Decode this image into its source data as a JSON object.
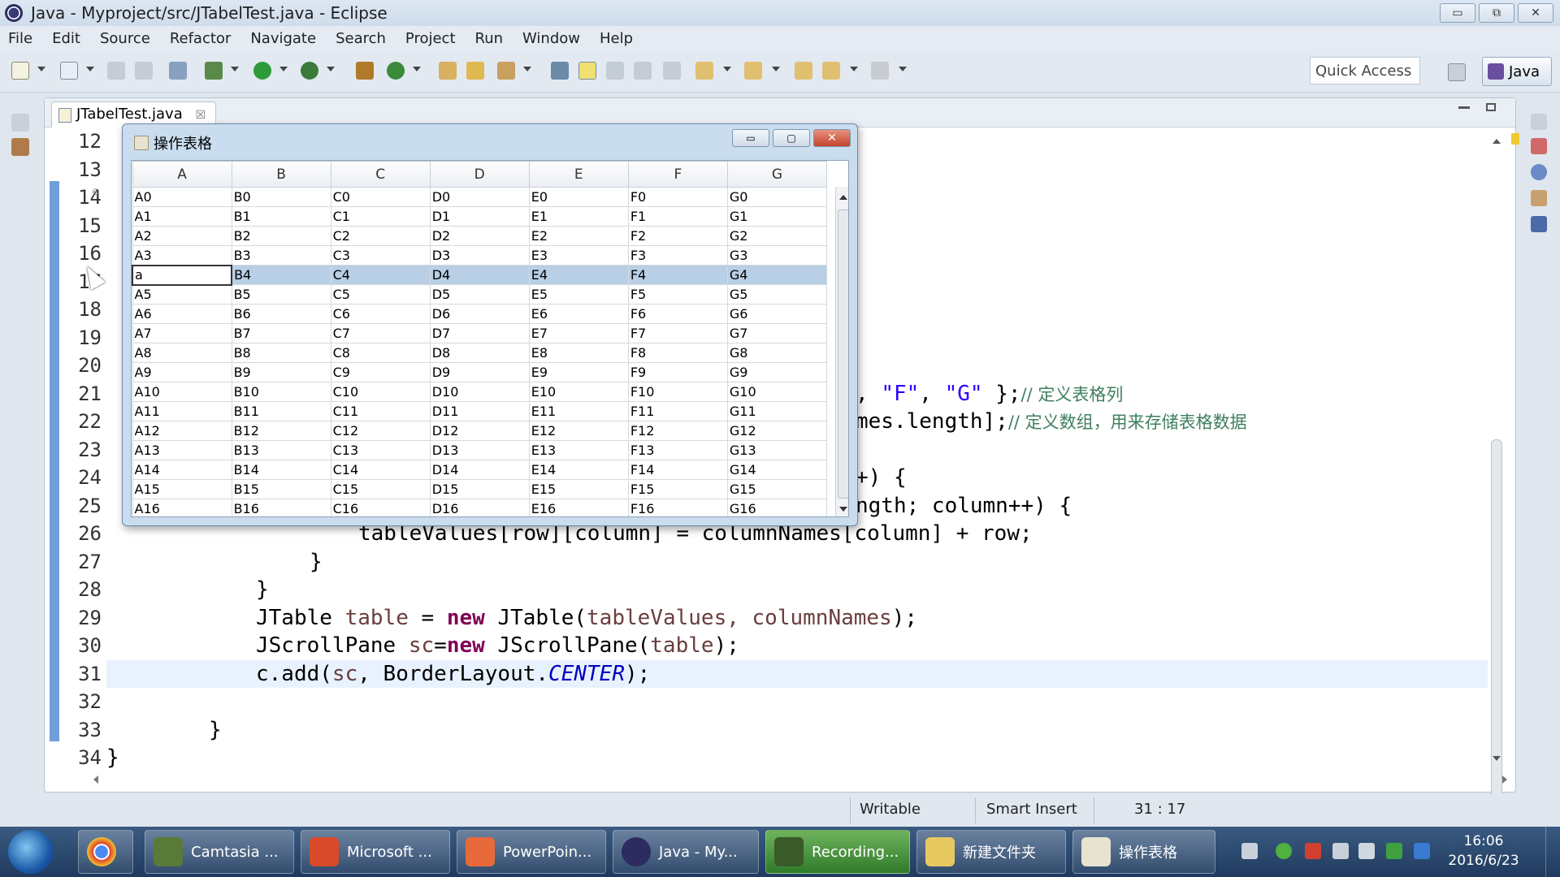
{
  "window": {
    "title": "Java - Myproject/src/JTabelTest.java - Eclipse",
    "controls": [
      "▭",
      "⧉",
      "✕"
    ]
  },
  "menu": [
    "File",
    "Edit",
    "Source",
    "Refactor",
    "Navigate",
    "Search",
    "Project",
    "Run",
    "Window",
    "Help"
  ],
  "toolbar": {
    "quick_access": "Quick Access",
    "perspective": "Java"
  },
  "editor": {
    "tab_label": "JTabelTest.java",
    "tab_close": "☒",
    "line_numbers": [
      "12",
      "13",
      "14",
      "15",
      "16",
      "17",
      "18",
      "19",
      "20",
      "21",
      "22",
      "23",
      "24",
      "25",
      "26",
      "27",
      "28",
      "29",
      "30",
      "31",
      "32",
      "33",
      "34"
    ],
    "visible_code": {
      "l21_a": ", ",
      "l21_f": "\"F\"",
      "l21_b": ", ",
      "l21_g": "\"G\"",
      "l21_c": " };",
      "l21_cm": "// 定义表格列",
      "l22_a": "mes.length];",
      "l22_cm": "// 定义数组，用来存储表格数据",
      "l24_a": "+) {",
      "l25_a": "ngth; column++) {",
      "l26_a": "tableValues[row][column] = columnNames[column] + row;",
      "l27_a": "}",
      "l28_a": "}",
      "l29_kw": "JTable ",
      "l29_var": "table",
      "l29_eq": " = ",
      "l29_new": "new",
      "l29_rest": " JTable(",
      "l29_args": "tableValues, columnNames",
      "l29_end": ");",
      "l30_kw": "JScrollPane ",
      "l30_var": "sc",
      "l30_eq": "=",
      "l30_new": "new",
      "l30_rest": " JScrollPane(",
      "l30_arg": "table",
      "l30_end": ");",
      "l31_a": "c.add(",
      "l31_var": "sc",
      "l31_b": ", BorderLayout.",
      "l31_fld": "CENTER",
      "l31_end": ");",
      "l33_a": "}",
      "l34_a": "}"
    }
  },
  "dialog": {
    "title": "操作表格",
    "controls": [
      "▭",
      "▢",
      "✕"
    ],
    "columns": [
      "A",
      "B",
      "C",
      "D",
      "E",
      "F",
      "G"
    ],
    "rows": [
      [
        "A0",
        "B0",
        "C0",
        "D0",
        "E0",
        "F0",
        "G0"
      ],
      [
        "A1",
        "B1",
        "C1",
        "D1",
        "E1",
        "F1",
        "G1"
      ],
      [
        "A2",
        "B2",
        "C2",
        "D2",
        "E2",
        "F2",
        "G2"
      ],
      [
        "A3",
        "B3",
        "C3",
        "D3",
        "E3",
        "F3",
        "G3"
      ],
      [
        "a",
        "B4",
        "C4",
        "D4",
        "E4",
        "F4",
        "G4"
      ],
      [
        "A5",
        "B5",
        "C5",
        "D5",
        "E5",
        "F5",
        "G5"
      ],
      [
        "A6",
        "B6",
        "C6",
        "D6",
        "E6",
        "F6",
        "G6"
      ],
      [
        "A7",
        "B7",
        "C7",
        "D7",
        "E7",
        "F7",
        "G7"
      ],
      [
        "A8",
        "B8",
        "C8",
        "D8",
        "E8",
        "F8",
        "G8"
      ],
      [
        "A9",
        "B9",
        "C9",
        "D9",
        "E9",
        "F9",
        "G9"
      ],
      [
        "A10",
        "B10",
        "C10",
        "D10",
        "E10",
        "F10",
        "G10"
      ],
      [
        "A11",
        "B11",
        "C11",
        "D11",
        "E11",
        "F11",
        "G11"
      ],
      [
        "A12",
        "B12",
        "C12",
        "D12",
        "E12",
        "F12",
        "G12"
      ],
      [
        "A13",
        "B13",
        "C13",
        "D13",
        "E13",
        "F13",
        "G13"
      ],
      [
        "A14",
        "B14",
        "C14",
        "D14",
        "E14",
        "F14",
        "G14"
      ],
      [
        "A15",
        "B15",
        "C15",
        "D15",
        "E15",
        "F15",
        "G15"
      ],
      [
        "A16",
        "B16",
        "C16",
        "D16",
        "E16",
        "F16",
        "G16"
      ]
    ],
    "selected_row": 4
  },
  "status": {
    "writable": "Writable",
    "insert_mode": "Smart Insert",
    "position": "31 : 17"
  },
  "taskbar": {
    "items": [
      "Camtasia ...",
      "Microsoft ...",
      "PowerPoin...",
      "Java - My...",
      "Recording...",
      "新建文件夹",
      "操作表格"
    ],
    "clock_time": "16:06",
    "clock_date": "2016/6/23"
  },
  "colors": {
    "keyword": "#7f0055",
    "string": "#2a00ff",
    "comment": "#3f7f5f",
    "local_var": "#6a3e3e",
    "static_field": "#0000c0",
    "selection": "#b8cfe5"
  }
}
